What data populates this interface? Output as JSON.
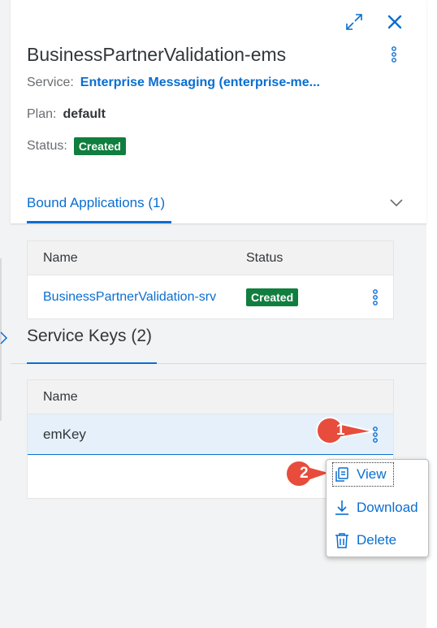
{
  "header": {
    "title": "BusinessPartnerValidation-ems",
    "service_label": "Service:",
    "service_value": "Enterprise Messaging (enterprise-me...",
    "plan_label": "Plan:",
    "plan_value": "default",
    "status_label": "Status:",
    "status_value": "Created"
  },
  "tabs": {
    "bound_applications": "Bound Applications (1)"
  },
  "bound_table": {
    "headers": [
      "Name",
      "Status"
    ],
    "rows": [
      {
        "name": "BusinessPartnerValidation-srv",
        "status": "Created"
      }
    ]
  },
  "service_keys": {
    "title": "Service Keys (2)",
    "headers": [
      "Name"
    ],
    "rows": [
      {
        "name": "emKey"
      }
    ]
  },
  "callouts": [
    "1",
    "2"
  ],
  "menu": {
    "items": [
      "View",
      "Download",
      "Delete"
    ]
  },
  "colors": {
    "accent": "#0a6ed1",
    "success": "#107e3e",
    "callout": "#e74c3c",
    "selected_row": "#e5f0fa"
  }
}
